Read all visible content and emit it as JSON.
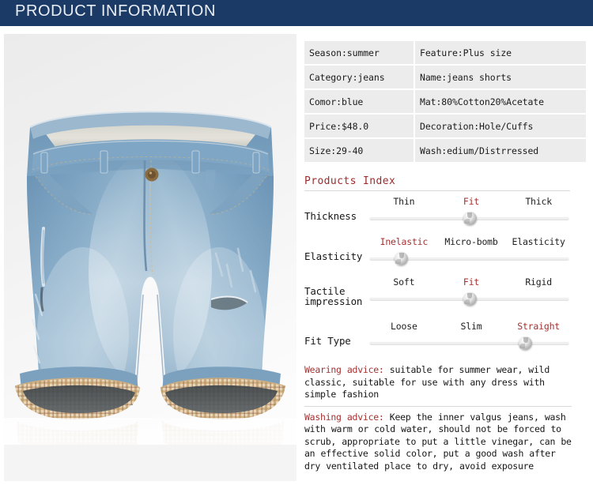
{
  "header": {
    "title": "PRODUCT INFORMATION",
    "bg_color": "#1c3a66",
    "text_color": "#e9eef5"
  },
  "product_image": {
    "alt": "blue denim jeans shorts with plaid folded cuffs",
    "background": "#efefef"
  },
  "spec_table": {
    "rows": [
      {
        "left": "Season:summer",
        "right": "Feature:Plus size"
      },
      {
        "left": "Category:jeans",
        "right": "Name:jeans shorts"
      },
      {
        "left": "Comor:blue",
        "right": "Mat:80%Cotton20%Acetate"
      },
      {
        "left": "Price:$48.0",
        "right": "Decoration:Hole/Cuffs"
      },
      {
        "left": "Size:29-40",
        "right": "Wash:edium/Distrressed"
      }
    ]
  },
  "products_index": {
    "heading": "Products Index",
    "accent_color": "#9c2b2b",
    "sliders": [
      {
        "label": "Thickness",
        "ticks": [
          "Thin",
          "Fit",
          "Thick"
        ],
        "tick_positions": [
          17,
          50,
          83
        ],
        "selected": "Fit",
        "selected_index": 1,
        "thumb_percent": 50
      },
      {
        "label": "Elasticity",
        "ticks": [
          "Inelastic",
          "Micro-bomb",
          "Elasticity"
        ],
        "tick_positions": [
          17,
          50,
          83
        ],
        "selected": "Inelastic",
        "selected_index": 0,
        "thumb_percent": 16
      },
      {
        "label": "Tactile impression",
        "label_line1": "Tactile",
        "label_line2": "impression",
        "ticks": [
          "Soft",
          "Fit",
          "Rigid"
        ],
        "tick_positions": [
          17,
          50,
          83
        ],
        "selected": "Fit",
        "selected_index": 1,
        "thumb_percent": 50
      },
      {
        "label": "Fit Type",
        "ticks": [
          "Loose",
          "Slim",
          "Straight"
        ],
        "tick_positions": [
          17,
          50,
          83
        ],
        "selected": "Straight",
        "selected_index": 2,
        "thumb_percent": 78
      }
    ]
  },
  "advice": {
    "wearing_key": "Wearing advice:",
    "wearing_text": " suitable for summer wear, wild classic, suitable for use with any dress with simple fashion",
    "washing_key": "Washing advice:",
    "washing_text": " Keep the inner valgus jeans, wash with warm or cold water, should not be forced to scrub, appropriate to put a little vinegar, can be an effective solid color, put a good wash after dry ventilated place to dry, avoid exposure"
  }
}
